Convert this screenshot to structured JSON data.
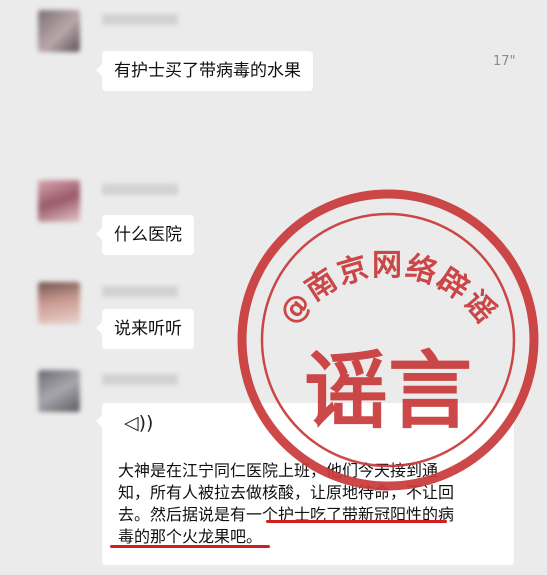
{
  "messages": [
    {
      "text": "有护士买了带病毒的水果"
    },
    {
      "text": "什么医院"
    },
    {
      "text": "说来听听"
    }
  ],
  "voice_message": {
    "icon": "voice-wave-icon",
    "duration": "17\"",
    "transcript": "大神是在江宁同仁医院上班，他们今天接到通知，所有人被拉去做核酸，让原地待命，不让回去。然后据说是有一个护士吃了带新冠阳性的病毒的那个火龙果吧。"
  },
  "stamp": {
    "arc_text": "@南京网络辟谣",
    "center_text": "谣言",
    "color": "#c93a3a"
  },
  "colors": {
    "background": "#ebebeb",
    "underline": "#d11f1f"
  }
}
